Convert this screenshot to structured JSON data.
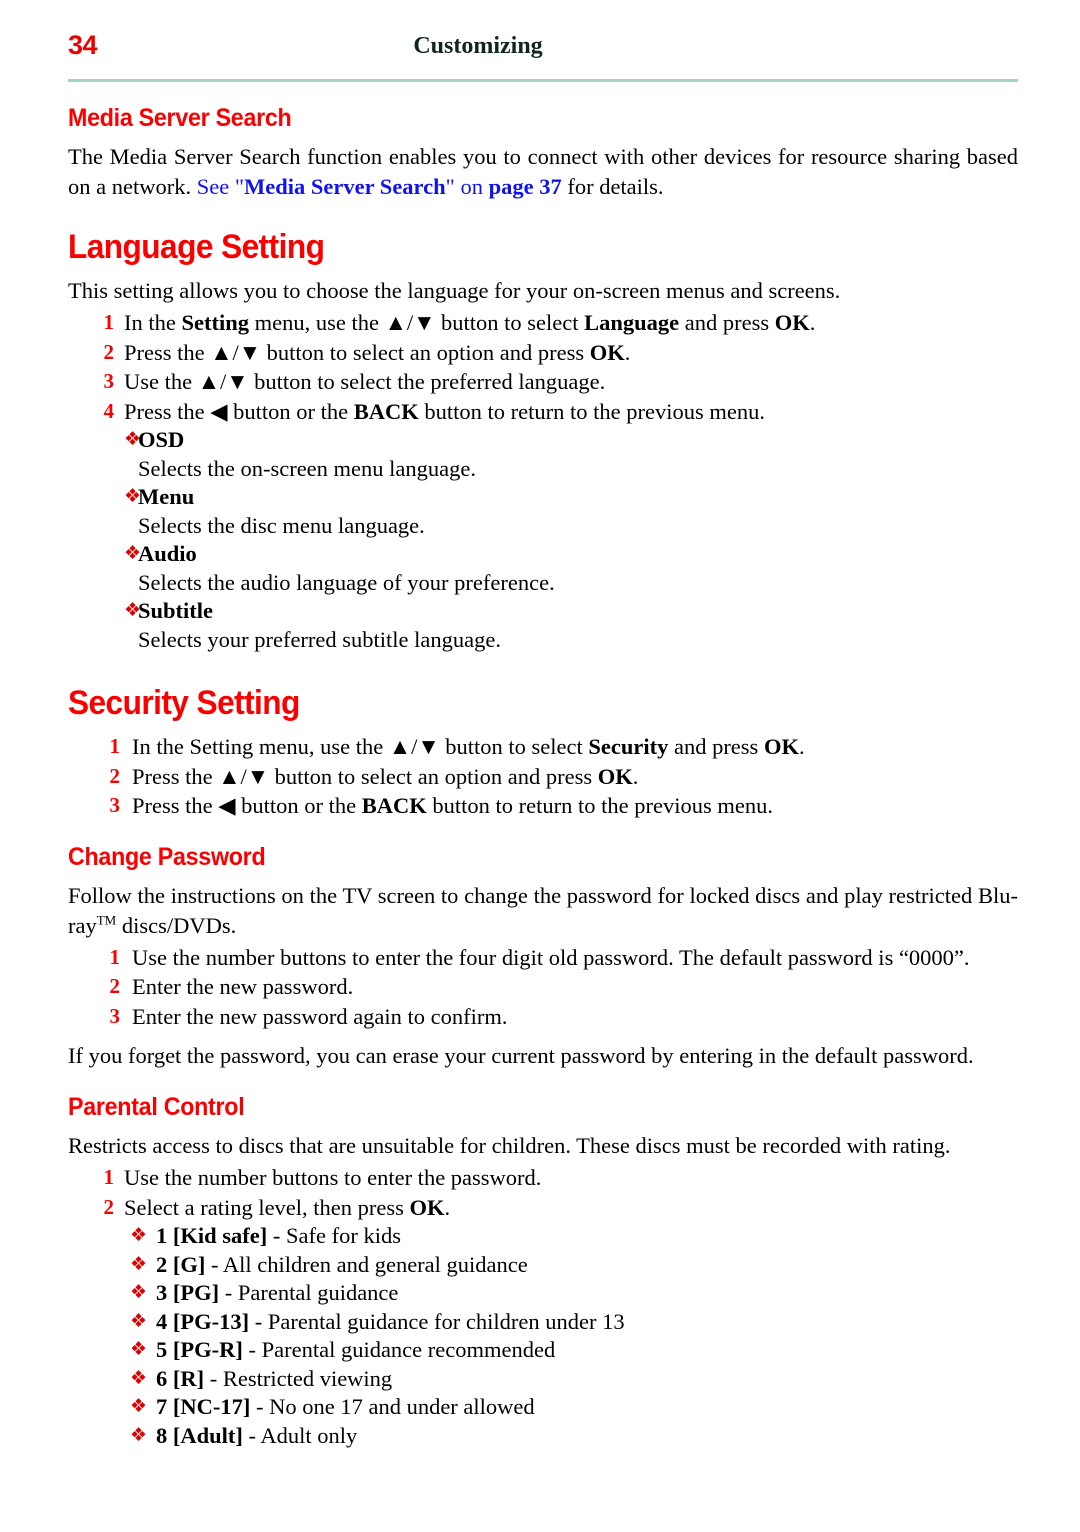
{
  "header": {
    "page_number": "34",
    "title": "Customizing",
    "rule_color": "#a3d3c2",
    "page_number_color": "#f10000"
  },
  "colors": {
    "heading_red": "#fb0000",
    "link_blue": "#1013ee",
    "bullet_red": "#e00000"
  },
  "media_server_search": {
    "heading": "Media Server Search",
    "para_lead": "The Media Server Search function enables you to connect with other devices for resource sharing based on a network. ",
    "xref_see": "See \"",
    "xref_title": "Media Server Search",
    "xref_quote_close": "\" ",
    "xref_on": "on ",
    "xref_page": "page 37",
    "xref_tail": " for details."
  },
  "language_setting": {
    "heading": "Language Setting",
    "intro": "This setting allows you to choose the language for your on-screen menus and screens.",
    "steps": [
      {
        "num": "1",
        "pre": "In the ",
        "b1": "Setting",
        "mid": " menu, use the ▲/▼ button to select ",
        "b2": "Language",
        "mid2": " and press ",
        "b3": "OK",
        "tail": "."
      },
      {
        "num": "2",
        "pre": "Press the ▲/▼ button to select an option and press ",
        "b1": "OK",
        "tail": "."
      },
      {
        "num": "3",
        "pre": "Use the ▲/▼ button to select the preferred language.",
        "tail": ""
      },
      {
        "num": "4",
        "pre": "Press the ◀ button or the ",
        "b1": "BACK",
        "mid": " button to return to the previous menu.",
        "tail": ""
      }
    ],
    "options": [
      {
        "bullet": "❖",
        "term": "OSD",
        "desc": "Selects the on-screen menu language."
      },
      {
        "bullet": "❖",
        "term": "Menu",
        "desc": "Selects the disc menu language."
      },
      {
        "bullet": "❖",
        "term": "Audio",
        "desc": "Selects the audio language of your preference."
      },
      {
        "bullet": "❖",
        "term": "Subtitle",
        "desc": "Selects your preferred subtitle language."
      }
    ]
  },
  "security_setting": {
    "heading": "Security Setting",
    "steps": [
      {
        "num": "1",
        "pre": "In the Setting menu, use the ▲/▼ button to select ",
        "b1": "Security",
        "mid": " and press ",
        "b2": "OK",
        "tail": "."
      },
      {
        "num": "2",
        "pre": "Press the ▲/▼ button to select an option and press ",
        "b1": "OK",
        "tail": "."
      },
      {
        "num": "3",
        "pre": "Press the ◀ button or the ",
        "b1": "BACK",
        "mid": " button to return to the previous menu.",
        "tail": ""
      }
    ]
  },
  "change_password": {
    "heading": "Change Password",
    "intro_pre": "Follow the instructions on the TV screen to change the password for locked discs and play restricted Blu-ray",
    "intro_tm": "TM",
    "intro_post": " discs/DVDs.",
    "steps": [
      {
        "num": "1",
        "text": "Use the number buttons to enter the four digit old password. The default password is “0000”."
      },
      {
        "num": "2",
        "text": "Enter the new password."
      },
      {
        "num": "3",
        "text": "Enter the new password again to confirm."
      }
    ],
    "outro": "If you forget the password, you can erase your current password by entering in the default password."
  },
  "parental_control": {
    "heading": "Parental Control",
    "intro": "Restricts access to discs that are unsuitable for children. These discs must be recorded with rating.",
    "steps": [
      {
        "num": "1",
        "pre": "Use the number buttons to enter the password.",
        "b1": "",
        "tail": ""
      },
      {
        "num": "2",
        "pre": "Select a rating level, then press ",
        "b1": "OK",
        "tail": "."
      }
    ],
    "ratings": [
      {
        "bullet": "❖",
        "label": "1 [Kid safe]",
        "text": " - Safe for kids"
      },
      {
        "bullet": "❖",
        "label": "2 [G]",
        "text": " - All children and general guidance"
      },
      {
        "bullet": "❖",
        "label": "3 [PG]",
        "text": " - Parental guidance"
      },
      {
        "bullet": "❖",
        "label": "4 [PG-13]",
        "text": " - Parental guidance for children under 13"
      },
      {
        "bullet": "❖",
        "label": "5 [PG-R]",
        "text": " - Parental guidance recommended"
      },
      {
        "bullet": "❖",
        "label": "6 [R]",
        "text": " - Restricted viewing"
      },
      {
        "bullet": "❖",
        "label": "7 [NC-17]",
        "text": " - No one 17 and under allowed"
      },
      {
        "bullet": "❖",
        "label": "8 [Adult]",
        "text": " - Adult only"
      }
    ]
  }
}
